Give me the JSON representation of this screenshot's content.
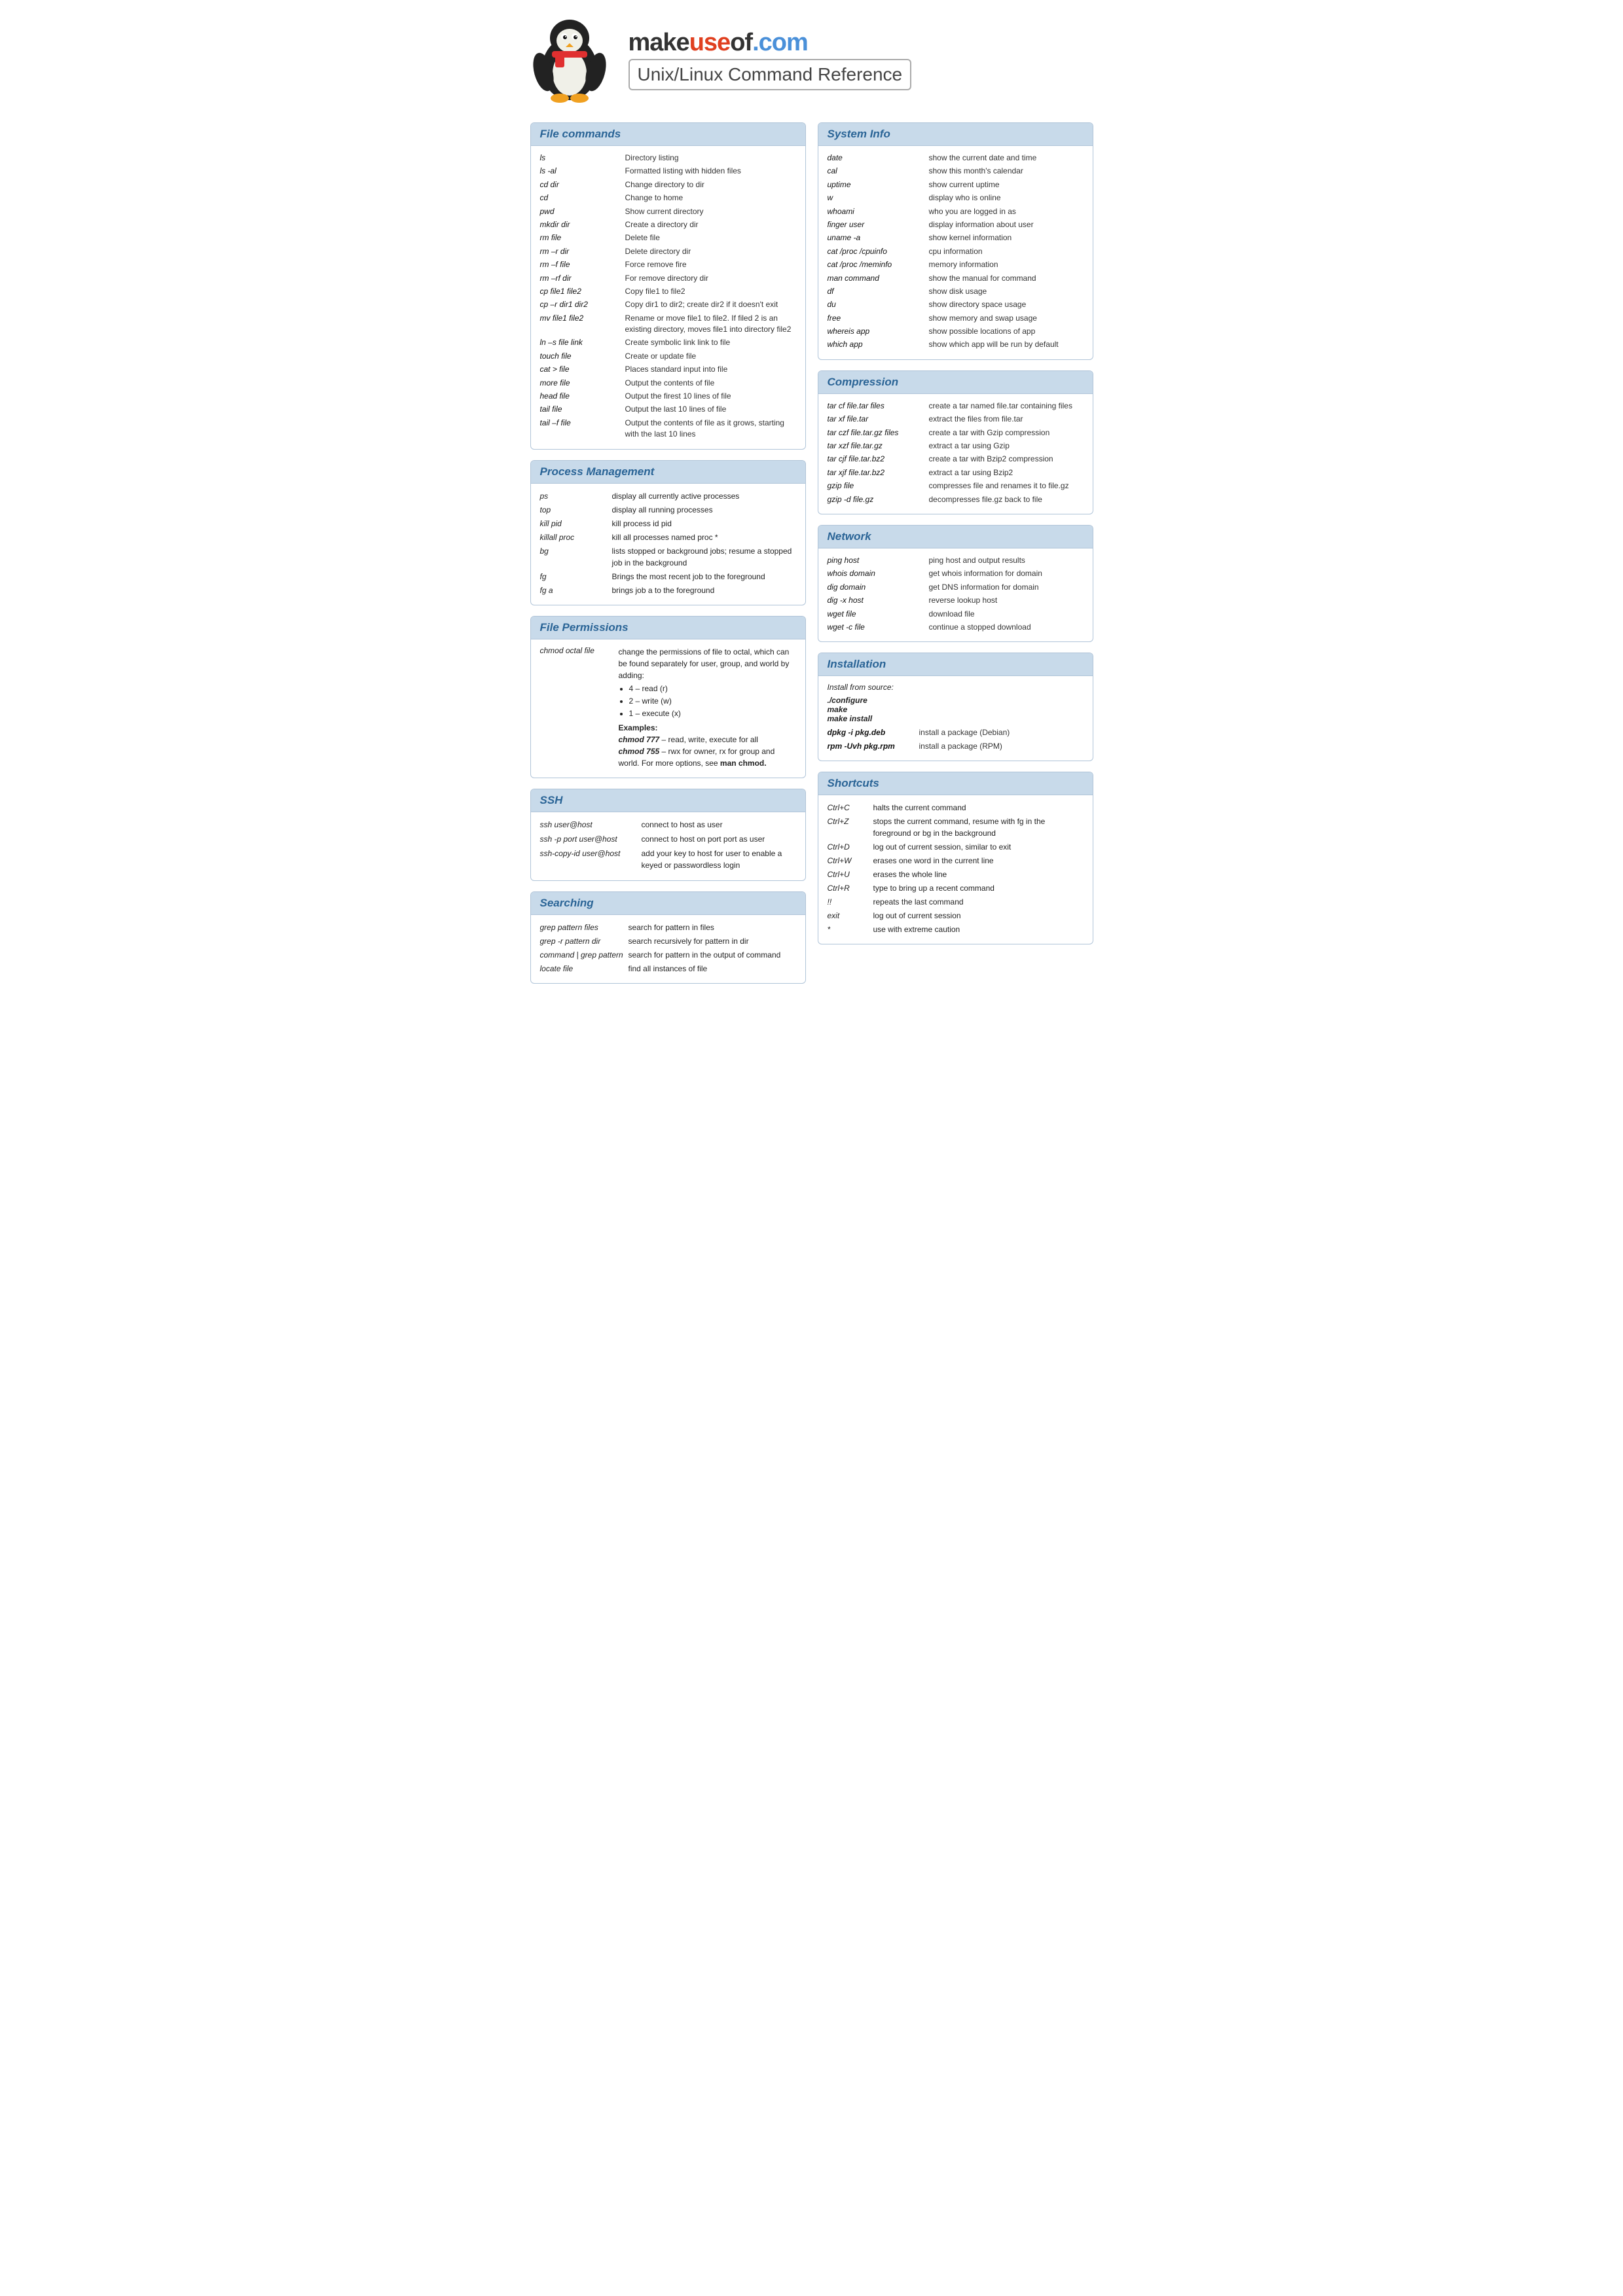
{
  "header": {
    "brand": "makeuseof.com",
    "title": "Unix/Linux Command Reference"
  },
  "sections": {
    "file_commands": {
      "title": "File commands",
      "commands": [
        {
          "cmd": "ls",
          "desc": "Directory listing"
        },
        {
          "cmd": "ls -al",
          "desc": "Formatted listing with hidden files"
        },
        {
          "cmd": "cd dir",
          "desc": "Change directory to dir"
        },
        {
          "cmd": "cd",
          "desc": "Change to home"
        },
        {
          "cmd": "pwd",
          "desc": "Show current directory"
        },
        {
          "cmd": "mkdir dir",
          "desc": "Create a directory dir"
        },
        {
          "cmd": "rm file",
          "desc": "Delete file"
        },
        {
          "cmd": "rm –r dir",
          "desc": "Delete directory dir"
        },
        {
          "cmd": "rm –f file",
          "desc": "Force remove fire"
        },
        {
          "cmd": "rm –rf dir",
          "desc": "For remove directory dir"
        },
        {
          "cmd": "cp file1 file2",
          "desc": "Copy file1 to file2"
        },
        {
          "cmd": "cp –r dir1 dir2",
          "desc": "Copy dir1 to dir2; create dir2 if it doesn't exit"
        },
        {
          "cmd": "mv file1 file2",
          "desc": "Rename or move file1 to file2. If filed 2 is an existing directory, moves file1 into directory  file2"
        },
        {
          "cmd": "ln –s file link",
          "desc": "Create symbolic link link to file"
        },
        {
          "cmd": "touch file",
          "desc": "Create or update file"
        },
        {
          "cmd": "cat > file",
          "desc": "Places standard input into file"
        },
        {
          "cmd": "more file",
          "desc": "Output the contents of file"
        },
        {
          "cmd": "head file",
          "desc": "Output the firest 10 lines of file"
        },
        {
          "cmd": "tail file",
          "desc": "Output the last 10 lines of file"
        },
        {
          "cmd": "tail –f file",
          "desc": "Output the contents of file as it grows, starting with the last 10 lines"
        }
      ]
    },
    "process_management": {
      "title": "Process Management",
      "commands": [
        {
          "cmd": "ps",
          "desc": "display all currently active processes"
        },
        {
          "cmd": "top",
          "desc": "display all running processes"
        },
        {
          "cmd": "kill pid",
          "desc": "kill process id pid"
        },
        {
          "cmd": "killall proc",
          "desc": "kill all processes named proc *"
        },
        {
          "cmd": "bg",
          "desc": "lists stopped or background jobs; resume a stopped job in the background"
        },
        {
          "cmd": "fg",
          "desc": "Brings the most recent job to the foreground"
        },
        {
          "cmd": "fg a",
          "desc": "brings job a to the foreground"
        }
      ]
    },
    "file_permissions": {
      "title": "File Permissions",
      "cmd": "chmod octal file",
      "desc_main": "change the permissions of file to octal, which can be found separately for user, group, and world by adding:",
      "options": [
        "4 – read (r)",
        "2 – write (w)",
        "1 – execute (x)"
      ],
      "examples_label": "Examples:",
      "examples": [
        "chmod 777 – read, write, execute for all",
        "chmod 755 – rwx for owner, rx for group and world. For more options, see man chmod."
      ]
    },
    "ssh": {
      "title": "SSH",
      "commands": [
        {
          "cmd": "ssh user@host",
          "desc": "connect to host as user"
        },
        {
          "cmd": "ssh -p port user@host",
          "desc": "connect to host on port port as user"
        },
        {
          "cmd": "ssh-copy-id user@host",
          "desc": "add your key to host for user to enable a keyed or passwordless login"
        }
      ]
    },
    "searching": {
      "title": "Searching",
      "commands": [
        {
          "cmd": "grep pattern files",
          "desc": "search for pattern in files"
        },
        {
          "cmd": "grep -r pattern dir",
          "desc": "search recursively for pattern in dir"
        },
        {
          "cmd": "command | grep pattern",
          "desc": "search for pattern in the output of command"
        },
        {
          "cmd": "locate file",
          "desc": "find all instances of file"
        }
      ]
    },
    "system_info": {
      "title": "System Info",
      "commands": [
        {
          "cmd": "date",
          "desc": "show the current date and time"
        },
        {
          "cmd": "cal",
          "desc": "show this month's calendar"
        },
        {
          "cmd": "uptime",
          "desc": "show current uptime"
        },
        {
          "cmd": "w",
          "desc": "display who is online"
        },
        {
          "cmd": "whoami",
          "desc": "who you are logged in as"
        },
        {
          "cmd": "finger user",
          "desc": "display information about user"
        },
        {
          "cmd": "uname -a",
          "desc": "show kernel information"
        },
        {
          "cmd": "cat /proc /cpuinfo",
          "desc": "cpu information"
        },
        {
          "cmd": "cat /proc /meminfo",
          "desc": "memory information"
        },
        {
          "cmd": "man command",
          "desc": "show the manual for command"
        },
        {
          "cmd": "df",
          "desc": "show disk usage"
        },
        {
          "cmd": "du",
          "desc": "show directory space usage"
        },
        {
          "cmd": "free",
          "desc": "show memory and swap usage"
        },
        {
          "cmd": "whereis app",
          "desc": "show possible locations of app"
        },
        {
          "cmd": "which app",
          "desc": "show which app will be run by default"
        }
      ]
    },
    "compression": {
      "title": "Compression",
      "commands": [
        {
          "cmd": "tar cf file.tar files",
          "desc": "create a tar named file.tar containing files"
        },
        {
          "cmd": "tar xf file.tar",
          "desc": "extract the files from file.tar"
        },
        {
          "cmd": "tar czf file.tar.gz files",
          "desc": "create a tar with Gzip compression"
        },
        {
          "cmd": "tar xzf file.tar.gz",
          "desc": "extract a tar using Gzip"
        },
        {
          "cmd": "tar cjf file.tar.bz2",
          "desc": "create a tar with Bzip2 compression"
        },
        {
          "cmd": "tar xjf file.tar.bz2",
          "desc": "extract a tar using Bzip2"
        },
        {
          "cmd": "gzip file",
          "desc": "compresses file and renames it to file.gz"
        },
        {
          "cmd": "gzip -d file.gz",
          "desc": "decompresses file.gz back to file"
        }
      ]
    },
    "network": {
      "title": "Network",
      "commands": [
        {
          "cmd": "ping host",
          "desc": "ping host and output results"
        },
        {
          "cmd": "whois domain",
          "desc": "get whois information for domain"
        },
        {
          "cmd": "dig domain",
          "desc": "get DNS information for domain"
        },
        {
          "cmd": "dig -x host",
          "desc": "reverse lookup host"
        },
        {
          "cmd": "wget file",
          "desc": "download file"
        },
        {
          "cmd": "wget -c file",
          "desc": "continue a stopped download"
        }
      ]
    },
    "installation": {
      "title": "Installation",
      "source_label": "Install from source:",
      "source_commands": [
        "./configure",
        "make",
        "make install"
      ],
      "pkg_commands": [
        {
          "cmd": "dpkg -i pkg.deb",
          "desc": "install a package (Debian)"
        },
        {
          "cmd": "rpm -Uvh pkg.rpm",
          "desc": "install a package (RPM)"
        }
      ]
    },
    "shortcuts": {
      "title": "Shortcuts",
      "commands": [
        {
          "cmd": "Ctrl+C",
          "desc": "halts the current command"
        },
        {
          "cmd": "Ctrl+Z",
          "desc": "stops the current command, resume with fg in the foreground or bg in the background"
        },
        {
          "cmd": "Ctrl+D",
          "desc": "log out of current session, similar to exit"
        },
        {
          "cmd": "Ctrl+W",
          "desc": "erases one word in the current line"
        },
        {
          "cmd": "Ctrl+U",
          "desc": "erases the whole line"
        },
        {
          "cmd": "Ctrl+R",
          "desc": "type to bring up a recent command"
        },
        {
          "cmd": "!!",
          "desc": "repeats the last command"
        },
        {
          "cmd": "exit",
          "desc": "log out of current session"
        },
        {
          "cmd": "*",
          "desc": "use with extreme caution"
        }
      ]
    }
  }
}
